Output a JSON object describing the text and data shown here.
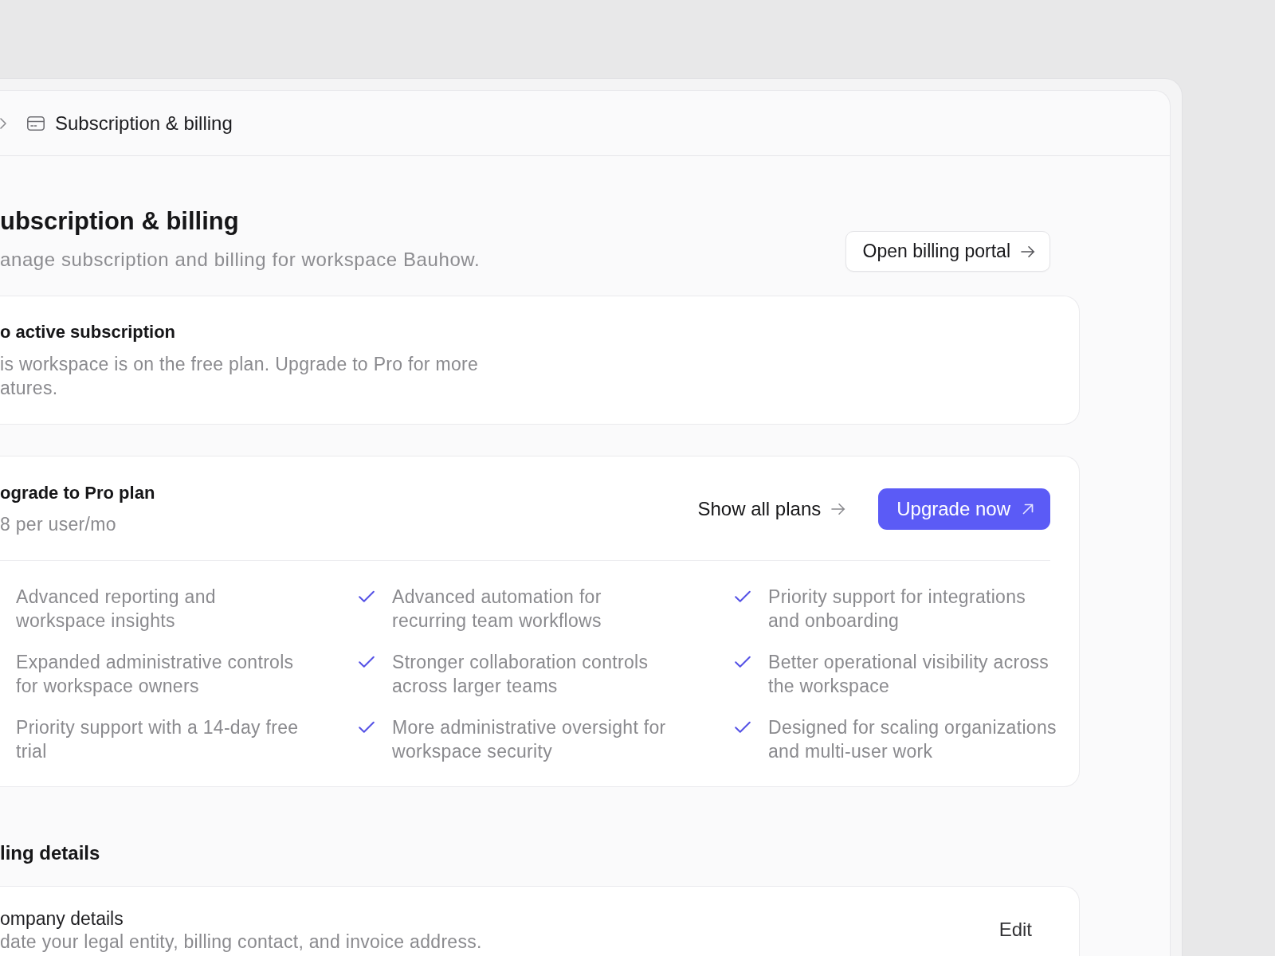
{
  "breadcrumb": {
    "current": "Subscription & billing"
  },
  "page_header": {
    "title": "ubscription & billing",
    "subtitle": "anage subscription and billing for workspace Bauhow.",
    "portal_button": "Open billing portal"
  },
  "subscription_status": {
    "title": "o active subscription",
    "description_lines": [
      "is workspace is on the free plan. Upgrade to Pro for more",
      "atures."
    ]
  },
  "upgrade_plan": {
    "title": "ograde to Pro plan",
    "price": "8 per user/mo",
    "show_plans_link": "Show all plans",
    "upgrade_button": "Upgrade now",
    "features": [
      {
        "kind": "text",
        "text": "Advanced reporting and workspace insights"
      },
      {
        "kind": "check",
        "text": "Advanced automation for recurring team workflows"
      },
      {
        "kind": "check",
        "text": "Priority support for integrations and onboarding"
      },
      {
        "kind": "text",
        "text": "Expanded administrative controls for workspace owners"
      },
      {
        "kind": "check",
        "text": "Stronger collaboration controls across larger teams"
      },
      {
        "kind": "check",
        "text": "Better operational visibility across the workspace"
      },
      {
        "kind": "text",
        "text": "Priority support with a 14-day free trial"
      },
      {
        "kind": "check",
        "text": "More administrative oversight for workspace security"
      },
      {
        "kind": "check",
        "text": "Designed for scaling organizations and multi-user work"
      }
    ]
  },
  "billing_details": {
    "heading": "ling details",
    "company": {
      "title": "ompany details",
      "description": "date your legal entity, billing contact, and invoice address.",
      "edit_button": "Edit"
    }
  }
}
